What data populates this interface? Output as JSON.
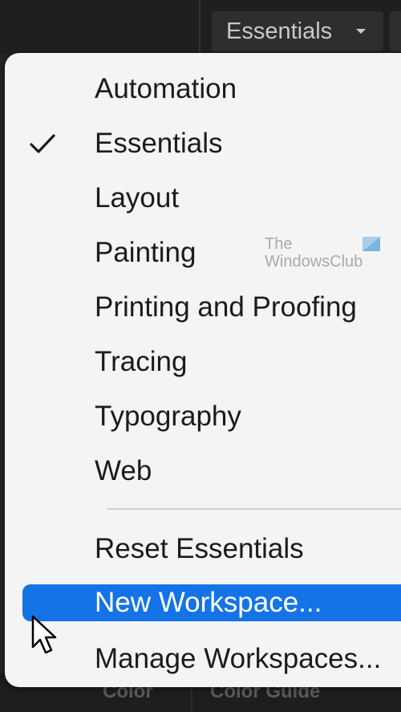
{
  "topbar": {
    "workspace_label": "Essentials"
  },
  "menu": {
    "workspaces": [
      {
        "label": "Automation",
        "checked": false
      },
      {
        "label": "Essentials",
        "checked": true
      },
      {
        "label": "Layout",
        "checked": false
      },
      {
        "label": "Painting",
        "checked": false
      },
      {
        "label": "Printing and Proofing",
        "checked": false
      },
      {
        "label": "Tracing",
        "checked": false
      },
      {
        "label": "Typography",
        "checked": false
      },
      {
        "label": "Web",
        "checked": false
      }
    ],
    "actions": [
      {
        "label": "Reset Essentials",
        "highlighted": false
      },
      {
        "label": "New Workspace...",
        "highlighted": true
      },
      {
        "label": "Manage Workspaces...",
        "highlighted": false
      }
    ]
  },
  "watermark": {
    "line1": "The",
    "line2": "WindowsClub"
  },
  "bottom_panel": {
    "tab_color": "Color",
    "tab_guide": "Color Guide"
  },
  "colors": {
    "menu_bg": "#f4f4f4",
    "highlight": "#1473e6",
    "app_bg": "#1f1f1f",
    "switcher_bg": "#2e2e2e"
  },
  "icons": {
    "checked_marker": "check-icon",
    "switcher_caret": "chevron-down-icon",
    "pointer": "cursor-icon"
  }
}
